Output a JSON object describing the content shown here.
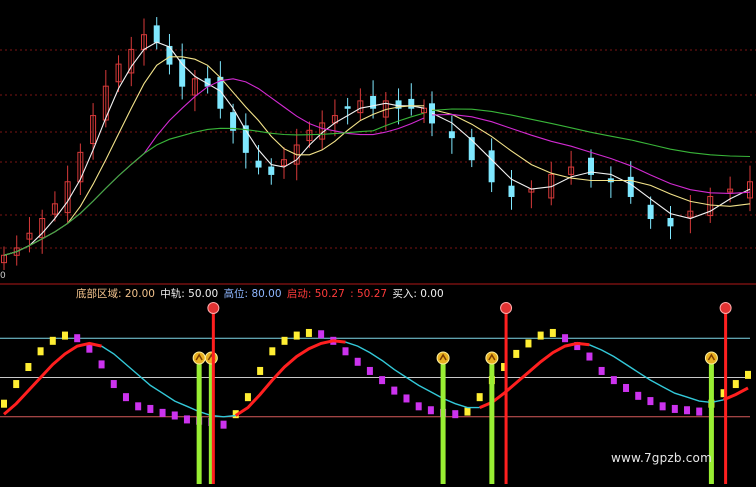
{
  "colors": {
    "background": "#000000",
    "candle_up": "#d83a3a",
    "candle_down": "#7fe8ff",
    "ma_white": "#f2f2f2",
    "ma_yellow": "#f3e38a",
    "ma_magenta": "#d12ad1",
    "ma_green": "#39b539",
    "grid": "#7a1515",
    "osc_yellow": "#ffee33",
    "osc_magenta": "#cc33ee",
    "osc_red": "#ff1f1f",
    "osc_cyan": "#33c8d8",
    "signal_green": "#99ee33",
    "level_line": "#c9c9c9"
  },
  "main_chart": {
    "axis_label": "0"
  },
  "indicator": {
    "legend": {
      "bottom_zone": "底部区域: 20.00",
      "mid_rail": "中轨: 50.00",
      "high_zone": "高位: 80.00",
      "start_a": "启动: 50.27",
      "start_b": ": 50.27",
      "buy": "买入: 0.00"
    },
    "levels": [
      20,
      50,
      80
    ],
    "buy_signal_icon": "up-arrow-ball-icon",
    "sell_signal_icon": "red-ball-icon"
  },
  "chart_data": [
    {
      "type": "candlestick",
      "title": "",
      "series": [
        {
          "name": "",
          "role": "close",
          "values": [
            10,
            11,
            13,
            15,
            17,
            20,
            24,
            29,
            33,
            36,
            38,
            40,
            39,
            36,
            33,
            34,
            33,
            30,
            27,
            24,
            22,
            21,
            23,
            25,
            27,
            28,
            29,
            30,
            31,
            30,
            31,
            30,
            30,
            30,
            28,
            26,
            23,
            20,
            18,
            19,
            21,
            22,
            21,
            20,
            18,
            15,
            14,
            16,
            18,
            19,
            20
          ]
        }
      ]
    },
    {
      "type": "line",
      "title": "",
      "y_levels": [
        20,
        50,
        80
      ],
      "series": [
        {
          "name": "",
          "role": "fast",
          "values": [
            30,
            45,
            58,
            70,
            78,
            82,
            80,
            72,
            60,
            45,
            35,
            28,
            26,
            23,
            21,
            18,
            17,
            16,
            14,
            22,
            35,
            55,
            70,
            78,
            82,
            84,
            83,
            78,
            70,
            62,
            55,
            48,
            40,
            34,
            28,
            25,
            23,
            22,
            24,
            35,
            48,
            58,
            68,
            76,
            82,
            84,
            80,
            74,
            66,
            55,
            48,
            42,
            36,
            32,
            28,
            26,
            25,
            24,
            30,
            38,
            45,
            52
          ]
        },
        {
          "name": "",
          "role": "slow",
          "values": [
            22,
            30,
            40,
            50,
            60,
            68,
            74,
            76,
            74,
            68,
            60,
            52,
            44,
            38,
            32,
            28,
            24,
            21,
            20,
            21,
            27,
            37,
            48,
            58,
            66,
            72,
            76,
            78,
            77,
            74,
            69,
            63,
            56,
            50,
            44,
            39,
            34,
            30,
            27,
            27,
            31,
            38,
            46,
            54,
            62,
            69,
            74,
            76,
            75,
            71,
            66,
            60,
            54,
            48,
            43,
            38,
            35,
            32,
            31,
            33,
            37,
            42
          ]
        }
      ],
      "buy_signals_at": [
        16,
        17,
        36,
        40,
        58
      ],
      "sell_signals_at": [
        17,
        41,
        59
      ]
    }
  ],
  "watermark": "www.7gpzb.com"
}
